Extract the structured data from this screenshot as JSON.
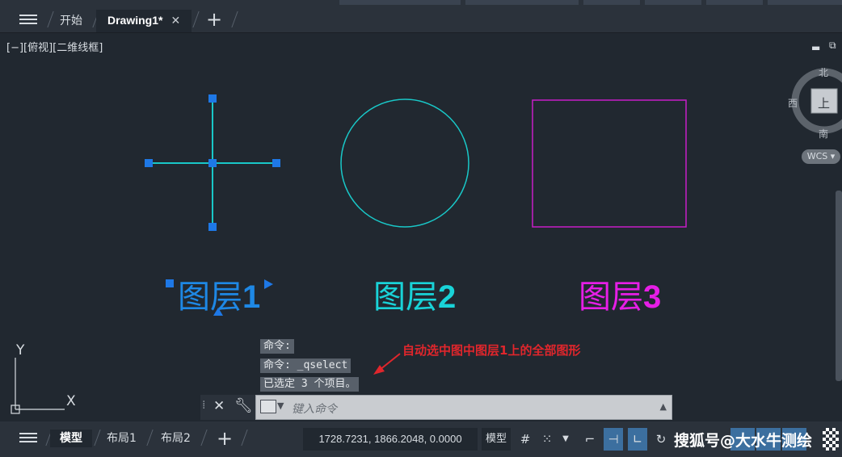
{
  "tabs": {
    "start": "开始",
    "active": "Drawing1*",
    "close": "✕",
    "add": "+"
  },
  "viewport": {
    "label": "[−][俯视][二维线框]"
  },
  "navcube": {
    "north": "北",
    "south": "南",
    "west": "西",
    "top": "上",
    "wcs": "WCS"
  },
  "drawing": {
    "layer1_text": "图层",
    "layer1_num": "1",
    "layer2_text": "图层",
    "layer2_num": "2",
    "layer3_text": "图层",
    "layer3_num": "3",
    "ucs_x": "X",
    "ucs_y": "Y",
    "colors": {
      "layer1": "#1e88e5",
      "layer2": "#19d3d8",
      "layer3": "#e61ee6",
      "grip": "#1e78e6",
      "cross": "#19c8c8"
    }
  },
  "command_history": [
    "命令:",
    "命令: _qselect",
    "已选定 3 个项目。"
  ],
  "annotation": "自动选中图中图层1上的全部图形",
  "command_input": {
    "placeholder": "键入命令"
  },
  "statusbar": {
    "model_tab": "模型",
    "layout1": "布局1",
    "layout2": "布局2",
    "add": "+",
    "coords": "1728.7231, 1866.2048, 0.0000",
    "model_btn": "模型"
  },
  "watermark": "搜狐号@大水牛测绘"
}
